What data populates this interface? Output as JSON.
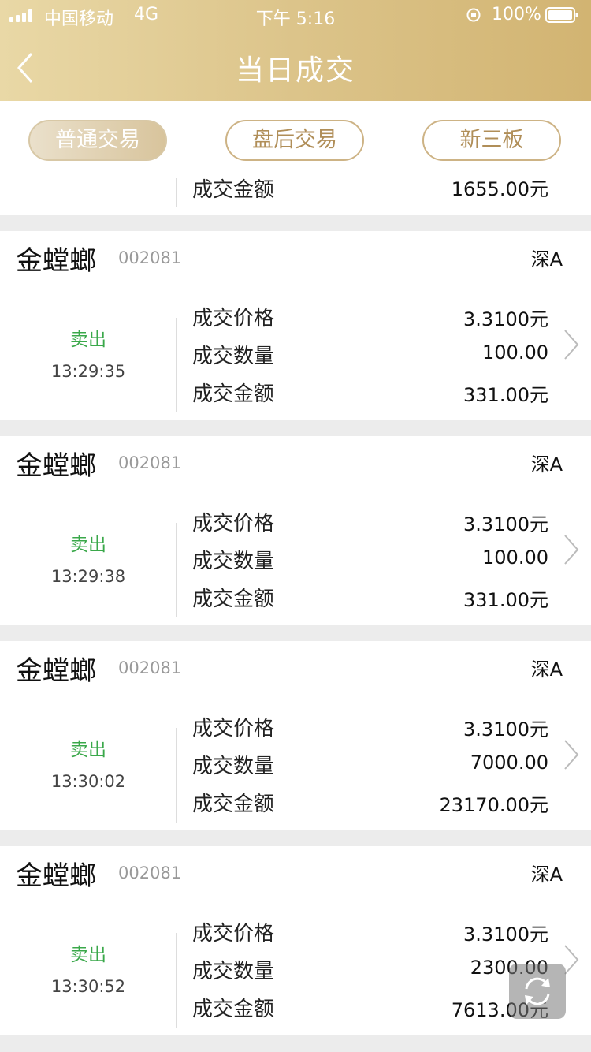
{
  "status_bar": {
    "carrier": "中国移动",
    "network": "4G",
    "time": "下午 5:16",
    "battery": "100%"
  },
  "header": {
    "title": "当日成交",
    "back_icon": "chevron-left-icon"
  },
  "tabs": [
    {
      "label": "普通交易",
      "active": true
    },
    {
      "label": "盘后交易",
      "active": false
    },
    {
      "label": "新三板",
      "active": false
    }
  ],
  "partial_top": {
    "label": "成交金额",
    "value": "1655.00元"
  },
  "row_labels": {
    "price": "成交价格",
    "quantity": "成交数量",
    "amount": "成交金额"
  },
  "trades": [
    {
      "name": "金螳螂",
      "code": "002081",
      "market": "深A",
      "side": "卖出",
      "time": "13:29:35",
      "price": "3.3100元",
      "quantity": "100.00",
      "amount": "331.00元"
    },
    {
      "name": "金螳螂",
      "code": "002081",
      "market": "深A",
      "side": "卖出",
      "time": "13:29:38",
      "price": "3.3100元",
      "quantity": "100.00",
      "amount": "331.00元"
    },
    {
      "name": "金螳螂",
      "code": "002081",
      "market": "深A",
      "side": "卖出",
      "time": "13:30:02",
      "price": "3.3100元",
      "quantity": "7000.00",
      "amount": "23170.00元"
    },
    {
      "name": "金螳螂",
      "code": "002081",
      "market": "深A",
      "side": "卖出",
      "time": "13:30:52",
      "price": "3.3100元",
      "quantity": "2300.00",
      "amount": "7613.00元"
    }
  ],
  "colors": {
    "header_gold": "#d8bd7e",
    "tab_border": "#cdb385",
    "sell_green": "#3aa84a"
  },
  "floating_button_icon": "refresh-icon"
}
